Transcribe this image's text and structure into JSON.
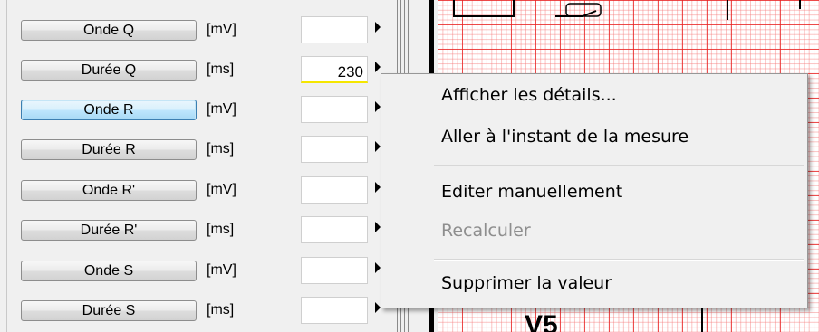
{
  "measurements": [
    {
      "label": "Onde Q",
      "unit": "[mV]",
      "value": ""
    },
    {
      "label": "Durée Q",
      "unit": "[ms]",
      "value": "230"
    },
    {
      "label": "Onde R",
      "unit": "[mV]",
      "value": ""
    },
    {
      "label": "Durée R",
      "unit": "[ms]",
      "value": ""
    },
    {
      "label": "Onde R'",
      "unit": "[mV]",
      "value": ""
    },
    {
      "label": "Durée R'",
      "unit": "[ms]",
      "value": ""
    },
    {
      "label": "Onde S",
      "unit": "[mV]",
      "value": ""
    },
    {
      "label": "Durée S",
      "unit": "[ms]",
      "value": ""
    }
  ],
  "context_menu": {
    "items": [
      {
        "label": "Afficher les détails...",
        "enabled": true
      },
      {
        "label": "Aller à l'instant de la mesure",
        "enabled": true
      },
      {
        "label": "Editer manuellement",
        "enabled": true
      },
      {
        "label": "Recalculer",
        "enabled": false
      },
      {
        "label": "Supprimer la valeur",
        "enabled": true
      }
    ]
  },
  "ecg": {
    "lead_label": "V5"
  },
  "colors": {
    "grid_major": "#e82020",
    "grid_minor": "#f57878",
    "edited_underline": "#f5e600",
    "active_button_border": "#3c7fb1"
  }
}
